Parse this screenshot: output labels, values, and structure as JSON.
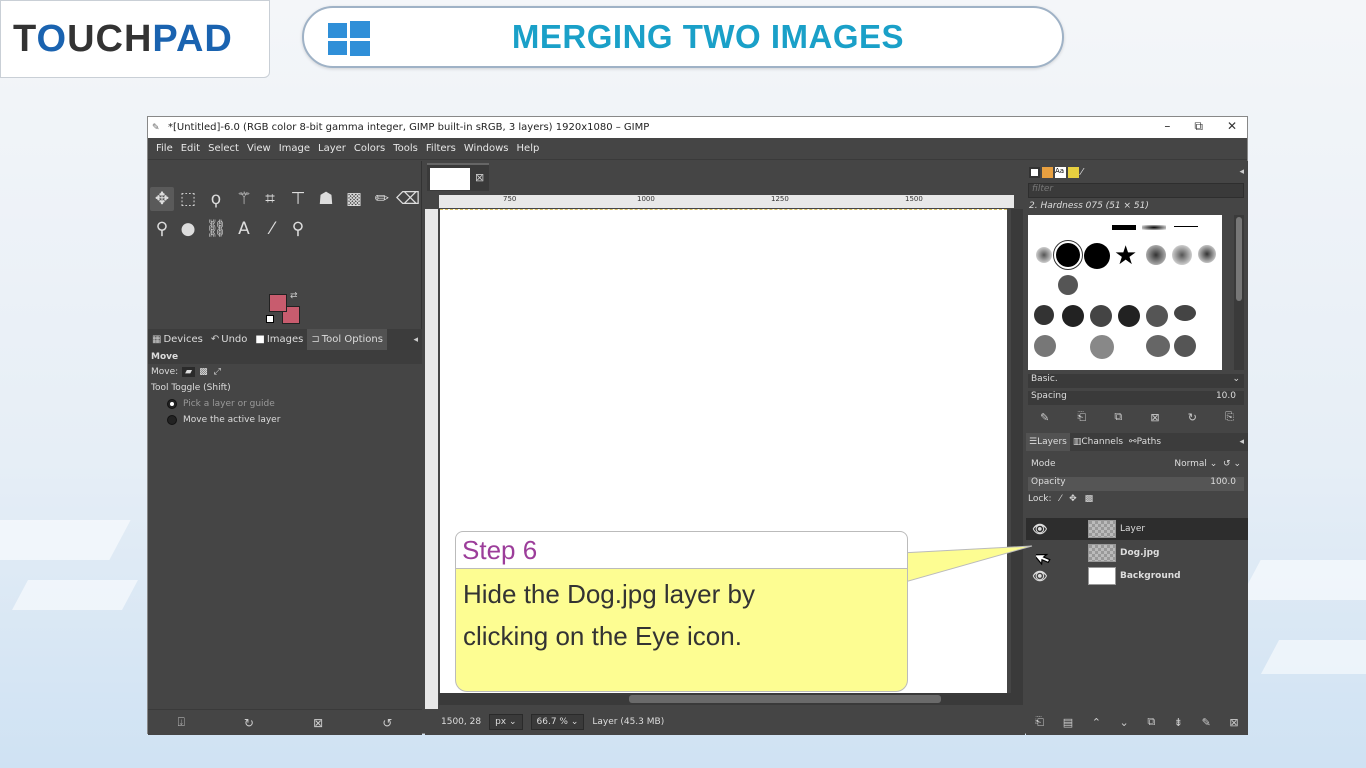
{
  "brand": {
    "logo_left": "T",
    "logo_accent": "O",
    "logo_mid": "UCH",
    "logo_right": "PAD"
  },
  "slide_title": "MERGING TWO IMAGES",
  "gimp": {
    "window_title": "*[Untitled]-6.0 (RGB color 8-bit gamma integer, GIMP built-in sRGB, 3 layers) 1920x1080 – GIMP",
    "window_controls": {
      "minimize": "–",
      "restore": "⧉",
      "close": "✕"
    },
    "menu": [
      "File",
      "Edit",
      "Select",
      "View",
      "Image",
      "Layer",
      "Colors",
      "Tools",
      "Filters",
      "Windows",
      "Help"
    ],
    "left_tabs": [
      "Devices",
      "Undo",
      "Images",
      "Tool Options"
    ],
    "tool_options": {
      "title": "Move",
      "move_label": "Move:",
      "toggle_label": "Tool Toggle  (Shift)",
      "option1": "Pick a layer or guide",
      "option2": "Move the active layer"
    },
    "ruler_marks": [
      "750",
      "1000",
      "1250",
      "1500"
    ],
    "status": {
      "coords": "1500, 28",
      "unit": "px",
      "zoom": "66.7 %",
      "layer_info": "Layer (45.3 MB)"
    },
    "brushes": {
      "filter_placeholder": "filter",
      "brush_name": "2. Hardness 075 (51 × 51)",
      "preset": "Basic.",
      "spacing_label": "Spacing",
      "spacing_value": "10.0"
    },
    "layers_tabs": [
      "Layers",
      "Channels",
      "Paths"
    ],
    "mode_label": "Mode",
    "mode_value": "Normal",
    "opacity_label": "Opacity",
    "opacity_value": "100.0",
    "lock_label": "Lock:",
    "layers": [
      {
        "name": "Layer",
        "visible": true,
        "selected": true
      },
      {
        "name": "Dog.jpg",
        "visible": true,
        "selected": false
      },
      {
        "name": "Background",
        "visible": true,
        "selected": false
      }
    ]
  },
  "callout": {
    "heading": "Step 6",
    "line1": "Hide the Dog.jpg layer by",
    "line2": "clicking on the Eye icon."
  },
  "colors": {
    "foreground": "#c85c6e",
    "title": "#1aa0c8",
    "step_heading": "#9c3d9a",
    "callout_bg": "#fdfd92"
  }
}
